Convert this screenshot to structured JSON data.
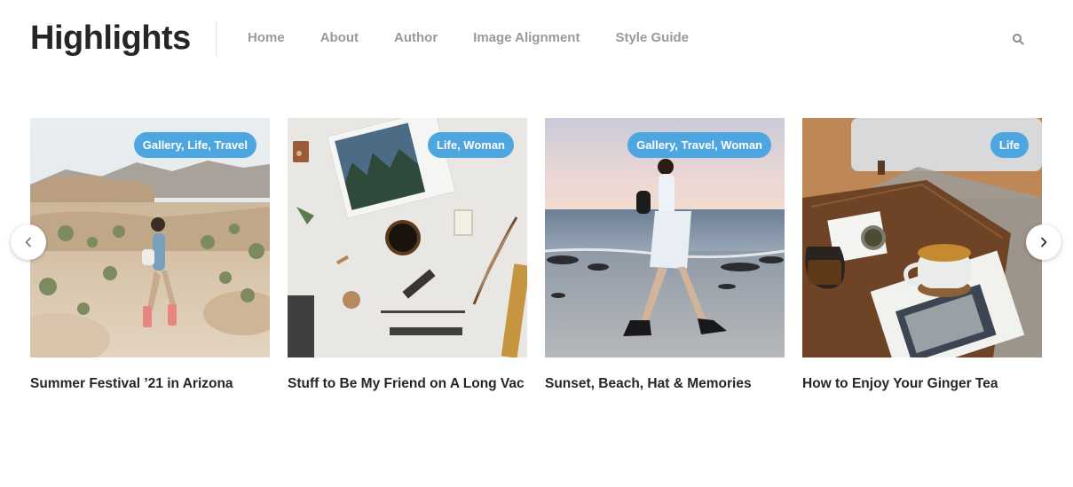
{
  "header": {
    "site_title": "Highlights",
    "nav": [
      {
        "label": "Home"
      },
      {
        "label": "About"
      },
      {
        "label": "Author"
      },
      {
        "label": "Image Alignment"
      },
      {
        "label": "Style Guide"
      }
    ],
    "search_icon": "search-icon"
  },
  "carousel": {
    "prev_icon": "chevron-left-icon",
    "next_icon": "chevron-right-icon",
    "posts": [
      {
        "categories": "Gallery, Life, Travel",
        "title": "Summer Festival ’21 in Arizona",
        "image": "desert-hiker-photo"
      },
      {
        "categories": "Life, Woman",
        "title": "Stuff to Be My Friend on A Long Vac",
        "image": "desk-flatlay-photo"
      },
      {
        "categories": "Gallery, Travel, Woman",
        "title": "Sunset, Beach, Hat & Memories",
        "image": "beach-walk-photo"
      },
      {
        "categories": "Life",
        "title": "How to Enjoy Your Ginger Tea",
        "image": "tea-table-photo"
      }
    ]
  },
  "colors": {
    "badge": "#4ea6e0",
    "title": "#262626",
    "nav": "#9a9a9a"
  }
}
